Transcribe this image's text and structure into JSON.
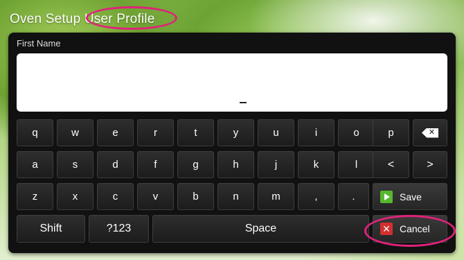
{
  "header": {
    "title_part1": "Oven Setup",
    "title_part2": "User Profile"
  },
  "form": {
    "field_label": "First Name",
    "value": ""
  },
  "keyboard": {
    "row1": [
      "q",
      "w",
      "e",
      "r",
      "t",
      "y",
      "u",
      "i",
      "o",
      "p"
    ],
    "row2": [
      "a",
      "s",
      "d",
      "f",
      "g",
      "h",
      "j",
      "k",
      "l"
    ],
    "row3": [
      "z",
      "x",
      "c",
      "v",
      "b",
      "n",
      "m",
      ",",
      "."
    ],
    "arrow_left": "<",
    "arrow_right": ">",
    "shift": "Shift",
    "symbols": "?123",
    "space": "Space",
    "backspace_icon": "backspace-icon"
  },
  "actions": {
    "save_label": "Save",
    "cancel_label": "Cancel",
    "save_color": "#55b82e",
    "cancel_color": "#d32f2f",
    "highlight_color": "#e0227a"
  }
}
